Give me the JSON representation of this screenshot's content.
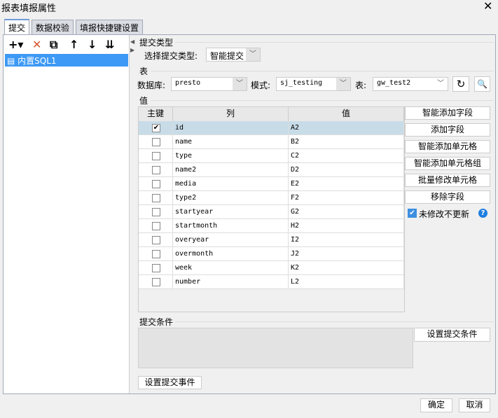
{
  "window": {
    "title": "报表填报属性",
    "close": "✕"
  },
  "tabs": [
    "提交",
    "数据校验",
    "填报快捷键设置"
  ],
  "left": {
    "toolbar": [
      "+▾",
      "✕",
      "⧉",
      "↑",
      "↓",
      "⇊"
    ],
    "items": [
      "内置SQL1"
    ]
  },
  "submit_type": {
    "section": "提交类型",
    "label": "选择提交类型:",
    "value": "智能提交"
  },
  "table_section": {
    "section": "表",
    "db_label": "数据库:",
    "db": "presto",
    "schema_label": "模式:",
    "schema": "sj_testing",
    "table_label": "表:",
    "table": "gw_test2"
  },
  "values": {
    "section": "值",
    "headers": [
      "主键",
      "列",
      "值"
    ],
    "rows": [
      {
        "key": true,
        "col": "id",
        "val": "A2"
      },
      {
        "key": false,
        "col": "name",
        "val": "B2"
      },
      {
        "key": false,
        "col": "type",
        "val": "C2"
      },
      {
        "key": false,
        "col": "name2",
        "val": "D2"
      },
      {
        "key": false,
        "col": "media",
        "val": "E2"
      },
      {
        "key": false,
        "col": "type2",
        "val": "F2"
      },
      {
        "key": false,
        "col": "startyear",
        "val": "G2"
      },
      {
        "key": false,
        "col": "startmonth",
        "val": "H2"
      },
      {
        "key": false,
        "col": "overyear",
        "val": "I2"
      },
      {
        "key": false,
        "col": "overmonth",
        "val": "J2"
      },
      {
        "key": false,
        "col": "week",
        "val": "K2"
      },
      {
        "key": false,
        "col": "number",
        "val": "L2"
      }
    ]
  },
  "side_buttons": [
    "智能添加字段",
    "添加字段",
    "智能添加单元格",
    "智能添加单元格组",
    "批量修改单元格",
    "移除字段"
  ],
  "no_update": {
    "label": "未修改不更新",
    "checked": true
  },
  "condition": {
    "section": "提交条件",
    "button": "设置提交条件"
  },
  "event_button": "设置提交事件",
  "ok": "确定",
  "cancel": "取消"
}
